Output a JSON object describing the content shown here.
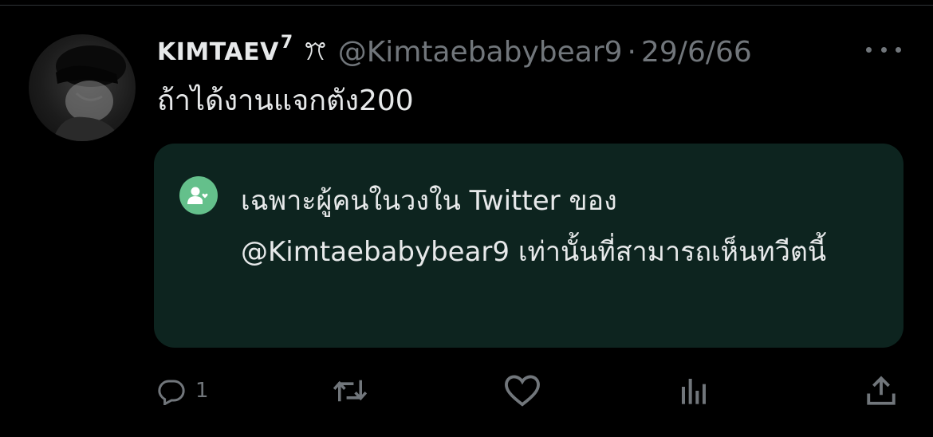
{
  "tweet": {
    "display_name": "KIMTAEV",
    "name_superscript": "7",
    "name_emoji": "ꔫ",
    "handle": "@Kimtaebabybear9",
    "separator": "·",
    "date": "29/6/66",
    "text": "ถ้าได้งานแจกตัง200",
    "avatar_icon": "profile-photo",
    "more_icon": "more-horizontal-icon"
  },
  "circle_notice": {
    "icon": "circle-people-icon",
    "text": "เฉพาะผู้คนในวงใน Twitter ของ @Kimtaebabybear9 เท่านั้นที่สามารถเห็นทวีตนี้",
    "background": "#0d241f",
    "icon_color": "#64c08b"
  },
  "actions": {
    "reply": {
      "icon": "reply-icon",
      "count": "1"
    },
    "retweet": {
      "icon": "retweet-icon"
    },
    "like": {
      "icon": "heart-icon"
    },
    "views": {
      "icon": "views-icon"
    },
    "share": {
      "icon": "share-icon"
    }
  },
  "colors": {
    "background": "#000000",
    "text_primary": "#e7e9ea",
    "text_secondary": "#71767b"
  }
}
